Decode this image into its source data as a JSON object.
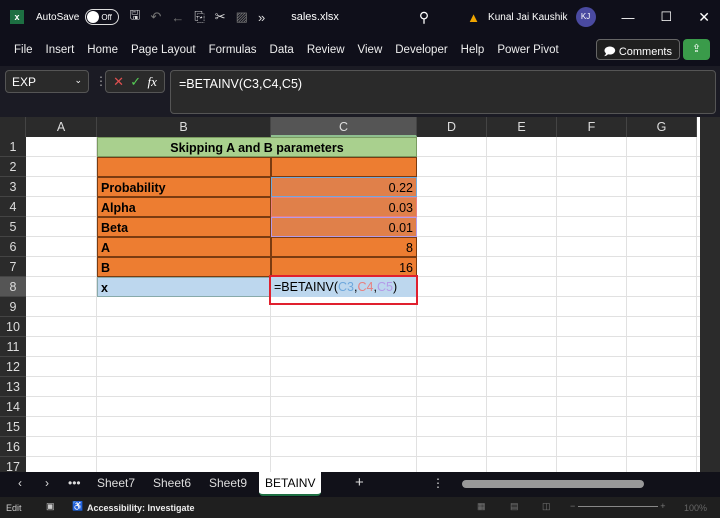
{
  "titlebar": {
    "autosave_label": "AutoSave",
    "autosave_state": "Off",
    "filename": "sales.xlsx",
    "user": "Kunal Jai Kaushik",
    "initials": "KJ"
  },
  "ribbon": {
    "tabs": [
      "File",
      "Insert",
      "Home",
      "Page Layout",
      "Formulas",
      "Data",
      "Review",
      "View",
      "Developer",
      "Help",
      "Power Pivot"
    ],
    "comments": "Comments"
  },
  "formula_bar": {
    "name_box": "EXP",
    "formula": "=BETAINV(C3,C4,C5)"
  },
  "grid": {
    "columns": [
      "A",
      "B",
      "C",
      "D",
      "E",
      "F",
      "G"
    ],
    "rows": [
      "1",
      "2",
      "3",
      "4",
      "5",
      "6",
      "7",
      "8",
      "9",
      "10",
      "11",
      "12",
      "13",
      "14",
      "15",
      "16",
      "17"
    ],
    "title": "Skipping A and B parameters",
    "labels": [
      "Probability",
      "Alpha",
      "Beta",
      "A",
      "B",
      "x"
    ],
    "values": [
      "0.22",
      "0.03",
      "0.01",
      "8",
      "16"
    ],
    "edit": {
      "prefix": "=BETAINV(",
      "ref1": "C3",
      "sep1": ",",
      "ref2": "C4",
      "sep2": ",",
      "ref3": "C5",
      "suffix": ")"
    }
  },
  "colors": {
    "header_green": "#a9d08e",
    "orange": "#ed7d31",
    "x_blue": "#bdd7ee",
    "highlight_red": "#e0202e"
  },
  "sheets": {
    "tabs": [
      "Sheet7",
      "Sheet6",
      "Sheet9",
      "BETAINV"
    ],
    "active": "BETAINV"
  },
  "status": {
    "mode": "Edit",
    "accessibility": "Accessibility: Investigate",
    "zoom": "100%"
  }
}
